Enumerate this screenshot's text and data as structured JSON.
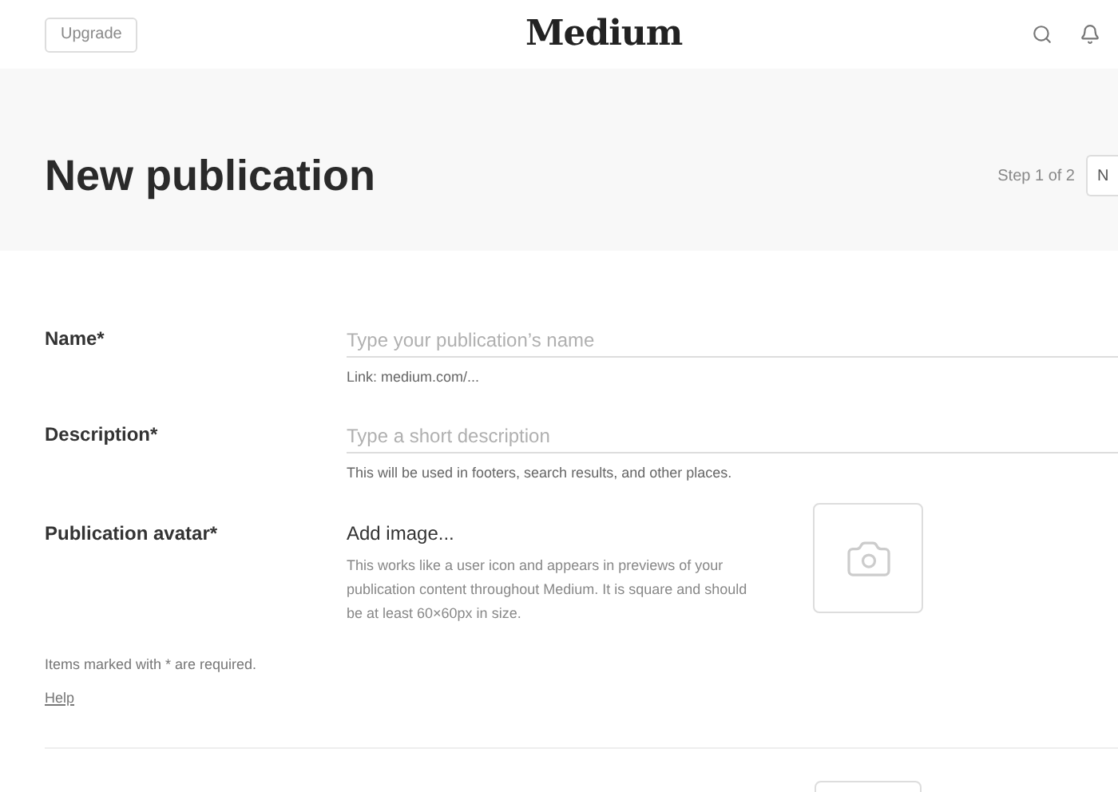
{
  "header": {
    "upgrade_button": "Upgrade",
    "logo": "Medium"
  },
  "hero": {
    "title": "New publication",
    "step": "Step 1 of 2",
    "next_button": "N"
  },
  "fields": [
    {
      "label": "Name*",
      "placeholder": "Type your publication’s name",
      "hint": "Link: medium.com/..."
    },
    {
      "label": "Description*",
      "placeholder": "Type a short description",
      "hint": "This will be used in footers, search results, and other places."
    }
  ],
  "avatar": {
    "label": "Publication avatar*",
    "action": "Add image...",
    "description": "This works like a user icon and appears in previews of your publication content throughout Medium. It is square and should be at least 60×60px in size."
  },
  "footer_note": {
    "text": "Items marked with * are required.",
    "help_link": "Help"
  }
}
